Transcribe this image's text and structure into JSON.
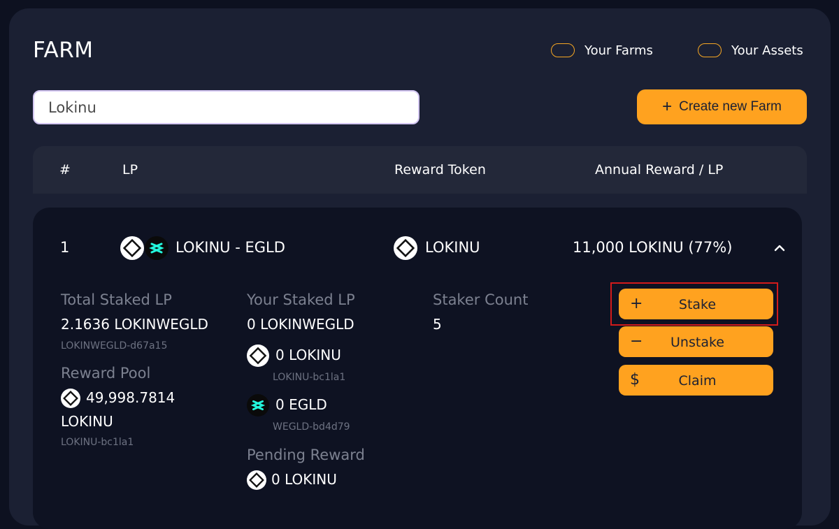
{
  "header": {
    "title": "FARM",
    "toggle_your_farms": "Your Farms",
    "toggle_your_assets": "Your Assets"
  },
  "search": {
    "value": "Lokinu"
  },
  "create_button": {
    "icon": "plus-icon",
    "label": "Create new Farm"
  },
  "table": {
    "columns": [
      "#",
      "LP",
      "Reward Token",
      "Annual Reward / LP"
    ]
  },
  "row": {
    "index": "1",
    "lp_pair": "LOKINU - EGLD",
    "reward_token": "LOKINU",
    "annual_reward": "11,000 LOKINU (77%)",
    "details": {
      "total_staked_label": "Total Staked LP",
      "total_staked_value": "2.1636 LOKINWEGLD",
      "total_staked_id": "LOKINWEGLD-d67a15",
      "reward_pool_label": "Reward Pool",
      "reward_pool_value": "49,998.7814",
      "reward_pool_unit": "LOKINU",
      "reward_pool_id": "LOKINU-bc1la1",
      "your_staked_label": "Your Staked LP",
      "your_staked_value": "0 LOKINWEGLD",
      "your_lokinu_value": "0 LOKINU",
      "your_lokinu_id": "LOKINU-bc1la1",
      "your_egld_value": "0 EGLD",
      "your_egld_id": "WEGLD-bd4d79",
      "pending_reward_label": "Pending Reward",
      "pending_reward_value": "0 LOKINU",
      "staker_count_label": "Staker Count",
      "staker_count_value": "5"
    }
  },
  "actions": {
    "stake": "Stake",
    "unstake": "Unstake",
    "claim": "Claim"
  },
  "colors": {
    "accent": "#ffa21f",
    "panel": "#1b2033",
    "highlight": "#d21b1b"
  }
}
